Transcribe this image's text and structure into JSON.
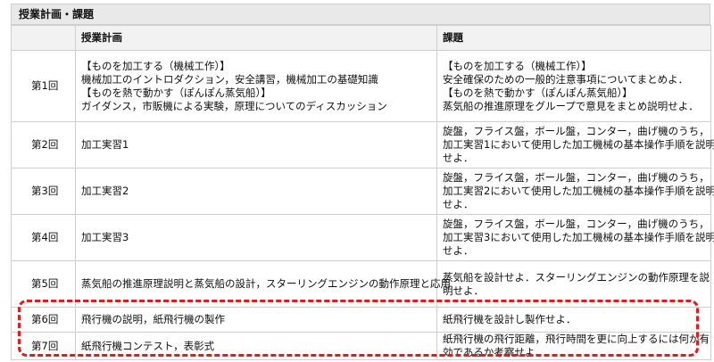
{
  "section": {
    "title": "授業計画・課題"
  },
  "table": {
    "headers": [
      "",
      "授業計画",
      "課題"
    ],
    "rows": [
      {
        "lesson": "第1回",
        "plan": [
          "【ものを加工する（機械工作）】",
          "機械加工のイントロダクション，安全講習，機械加工の基礎知識",
          "【ものを熱で動かす（ぽんぽん蒸気船）】",
          "ガイダンス，市販機による実験，原理についてのディスカッション"
        ],
        "task": [
          "【ものを加工する（機械工作）】",
          "安全確保のための一般的注意事項についてまとめよ．",
          "【ものを熱で動かす（ぽんぽん蒸気船）】",
          "蒸気船の推進原理をグループで意見をまとめ説明せよ．"
        ]
      },
      {
        "lesson": "第2回",
        "plan": [
          "加工実習1"
        ],
        "task": [
          "旋盤，フライス盤，ボール盤，コンター，曲げ機のうち，",
          "加工実習1において使用した加工機械の基本操作手順を説明",
          "せよ．"
        ]
      },
      {
        "lesson": "第3回",
        "plan": [
          "加工実習2"
        ],
        "task": [
          "旋盤，フライス盤，ボール盤，コンター，曲げ機のうち，",
          "加工実習2において使用した加工機械の基本操作手順を説明",
          "せよ．"
        ]
      },
      {
        "lesson": "第4回",
        "plan": [
          "加工実習3"
        ],
        "task": [
          "旋盤，フライス盤，ボール盤，コンター，曲げ機のうち，",
          "加工実習3において使用した加工機械の基本操作手順を説明",
          "せよ．"
        ]
      },
      {
        "lesson": "第5回",
        "plan": [
          "蒸気船の推進原理説明と蒸気船の設計，スターリングエンジンの動作原理と応用"
        ],
        "task": [
          "蒸気船を設計せよ．スターリングエンジンの動作原理を説",
          "明せよ．"
        ]
      },
      {
        "lesson": "第6回",
        "plan": [
          "飛行機の説明，紙飛行機の製作"
        ],
        "task": [
          "紙飛行機を設計し製作せよ．"
        ]
      },
      {
        "lesson": "第7回",
        "plan": [
          "紙飛行機コンテスト，表彰式"
        ],
        "task": [
          "紙飛行機の飛行距離，飛行時間を更に向上するには何が有",
          "効であるか考察せよ"
        ]
      }
    ]
  },
  "highlight": {
    "color": "#e8191b"
  }
}
